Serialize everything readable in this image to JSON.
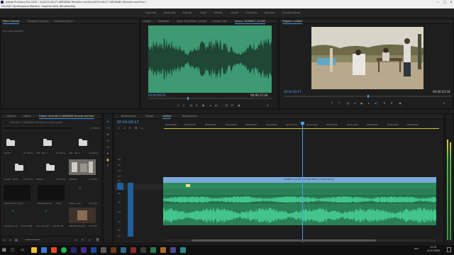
{
  "window": {
    "title": "Adobe Premiere Pro 2019 - D:\\2019-06-27 WEDDING Michelle and Kian\\2019-06-27 WEDDING Michelle and Kian *",
    "controls": [
      "—",
      "□",
      "✕"
    ]
  },
  "menu": [
    "File",
    "Edit",
    "Clip",
    "Sequence",
    "Markers",
    "Graphics",
    "View",
    "Window",
    "Help"
  ],
  "workspaces": [
    "Learning",
    "Assembly",
    "Editing",
    "Color",
    "Effects",
    "Audio",
    "Graphics",
    "Libraries",
    "Storyboarding"
  ],
  "effect_controls": {
    "tabs": [
      "Effect Controls",
      "Essential Graphics",
      "Essential Sound"
    ],
    "empty_message": "(no clips selected)"
  },
  "source_monitor": {
    "tabs": [
      "Lumetri",
      "Metadata",
      "Audio Track Mixer: untitled",
      "Lumetri Color",
      "Source: 20190627_111303"
    ],
    "timecode_in": "00:00:09:19",
    "timecode_out": "00:00:17:04"
  },
  "program_monitor": {
    "title": "Program: untitled",
    "timecode_in": "00:04:09:17",
    "timecode_out": "00:00:03:16"
  },
  "project_panel": {
    "tabs": [
      "Libraries",
      "Effects",
      "Project: 2019-06-27 WEDDING Michelle and Kian"
    ],
    "path": "2019-06-27 WEDDING Michelle and Kian.prproj",
    "item_count": "31 Items",
    "items": [
      {
        "name": "Sound",
        "meta": "11 Items"
      },
      {
        "name": "LTR - Die 1",
        "meta": "12 Items"
      },
      {
        "name": "LTR - Die 2",
        "meta": "14 Items"
      },
      {
        "name": "Legacy",
        "meta": ""
      },
      {
        "name": "pre00 - birds",
        "meta": "15 Items"
      },
      {
        "name": "Mobile",
        "meta": "16 Items"
      },
      {
        "name": "untitled",
        "meta": "1:02:04"
      },
      {
        "name": "",
        "meta": ""
      },
      {
        "name": "Adjustment Layer",
        "meta": ""
      },
      {
        "name": "Bendlinglines",
        "meta": "0:00"
      },
      {
        "name": "Pikobo_Cat...",
        "meta": "3:25:04"
      },
      {
        "name": "",
        "meta": ""
      },
      {
        "name": "Creditos_Ca...",
        "meta": "3:00:59:08"
      },
      {
        "name": "Sun_and_So...",
        "meta": "3:05:00:08"
      },
      {
        "name": "Wedding Ballro...",
        "meta": "3:03:45"
      },
      {
        "name": "0228",
        "meta": "4:08"
      }
    ]
  },
  "timeline": {
    "tabs": [
      "Bendinglines",
      "Strings",
      "untitled",
      "Bendinglines"
    ],
    "timecode": "00:04:09:17",
    "ruler": [
      "00:03:48:00",
      "00:03:52:00",
      "00:03:56:00",
      "00:04:00:00",
      "00:04:04:00",
      "00:04:08:00",
      "00:04:12:00",
      "00:04:16:00",
      "00:04:20:00",
      "00:04:24:00",
      "00:04:28:00",
      "00:04:32:00",
      "00:04:36:00"
    ],
    "tracks": [
      "V6",
      "V5",
      "V4",
      "V3",
      "V2",
      "V1",
      "A1",
      "A2",
      "A3",
      "A4",
      "A5",
      "A6"
    ],
    "clip_labels": [
      "20190627_111303.mp4 [V]",
      "20190627_111303.mp4 [V]"
    ]
  },
  "taskbar": {
    "time": "11:15",
    "date": "01.01.2020",
    "lang": "DEU"
  }
}
